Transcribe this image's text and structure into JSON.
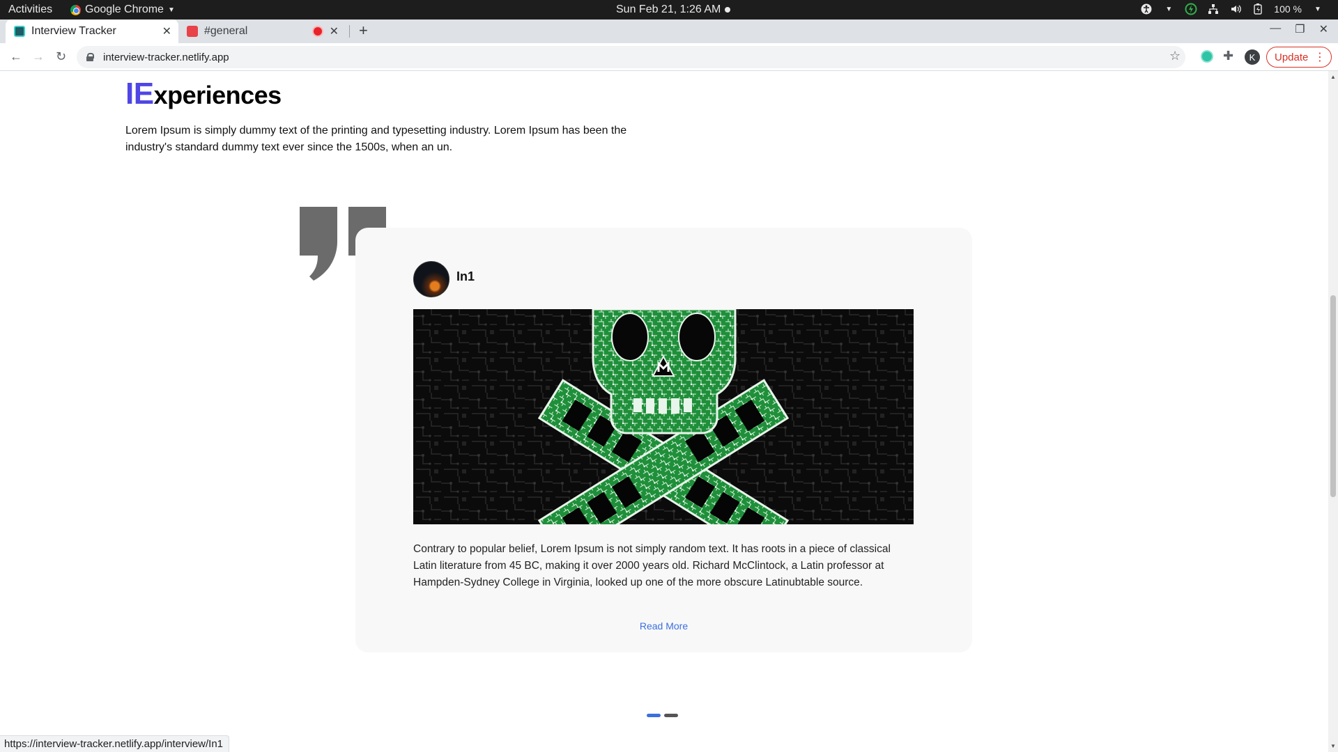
{
  "system_bar": {
    "activities": "Activities",
    "app_name": "Google Chrome",
    "clock": "Sun Feb 21,  1:26 AM",
    "battery": "100 %"
  },
  "browser": {
    "tabs": [
      {
        "title": "Interview Tracker",
        "active": true,
        "favicon": "interview-tracker-favicon"
      },
      {
        "title": "#general",
        "active": false,
        "favicon": "slack-favicon",
        "recording": true
      }
    ],
    "url": "interview-tracker.netlify.app",
    "profile_initial": "K",
    "update_label": "Update",
    "status_url": "https://interview-tracker.netlify.app/interview/In1"
  },
  "section": {
    "heading_accent": "IE",
    "heading_rest": "xperiences",
    "intro": "Lorem Ipsum is simply dummy text of the printing and typesetting industry. Lorem Ipsum has been the industry's standard dummy text ever since the 1500s, when an un."
  },
  "card": {
    "author": "In1",
    "image": "skull-and-crossbones-circuit-board",
    "excerpt": "Contrary to popular belief, Lorem Ipsum is not simply random text. It has roots in a piece of classical Latin literature from 45 BC, making it over 2000 years old. Richard McClintock, a Latin professor at Hampden-Sydney College in Virginia, looked up one of the more obscure Latinubtable source.",
    "read_more": "Read More"
  },
  "carousel": {
    "slides": 2,
    "active_index": 0
  },
  "colors": {
    "accent": "#4f46e5",
    "link": "#3b6fe0",
    "circuit_green": "#1f8f3a"
  }
}
